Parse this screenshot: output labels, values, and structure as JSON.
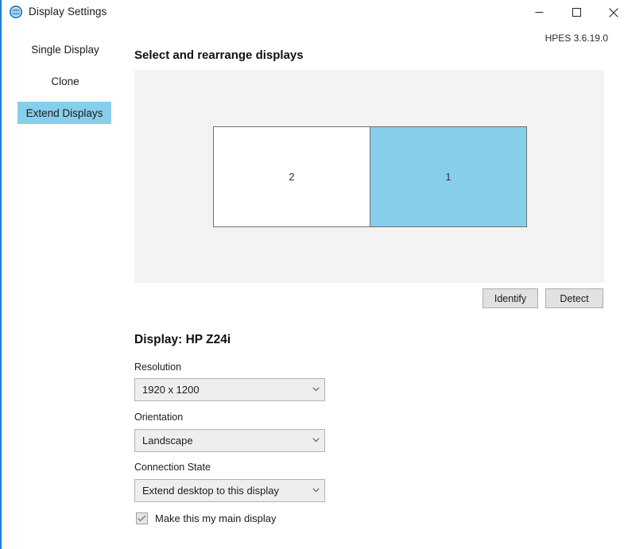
{
  "window": {
    "title": "Display Settings",
    "app_icon": "display-settings-icon",
    "version": "HPES 3.6.19.0",
    "accent_color": "#1f7fd4",
    "controls": {
      "minimize": "minimize-icon",
      "maximize": "maximize-icon",
      "close": "close-icon"
    }
  },
  "sidebar": {
    "items": [
      {
        "label": "Single Display",
        "selected": false
      },
      {
        "label": "Clone",
        "selected": false
      },
      {
        "label": "Extend Displays",
        "selected": true
      }
    ],
    "selected_color": "#87ceeb"
  },
  "main": {
    "section_heading": "Select and rearrange displays",
    "preview": {
      "background": "#f3f3f3",
      "monitors": [
        {
          "number": "2",
          "selected": false,
          "fill": "#ffffff",
          "position": "left"
        },
        {
          "number": "1",
          "selected": true,
          "fill": "#87ceeb",
          "position": "right"
        }
      ]
    },
    "buttons": {
      "identify": "Identify",
      "detect": "Detect"
    },
    "display_title": "Display: HP Z24i",
    "fields": [
      {
        "label": "Resolution",
        "value": "1920 x 1200",
        "icon": "chevron-down-icon"
      },
      {
        "label": "Orientation",
        "value": "Landscape",
        "icon": "chevron-down-icon"
      },
      {
        "label": "Connection State",
        "value": "Extend desktop to this display",
        "icon": "chevron-down-icon"
      }
    ],
    "checkbox": {
      "label": "Make this my main display",
      "checked": true,
      "icon": "checkmark-icon"
    }
  }
}
